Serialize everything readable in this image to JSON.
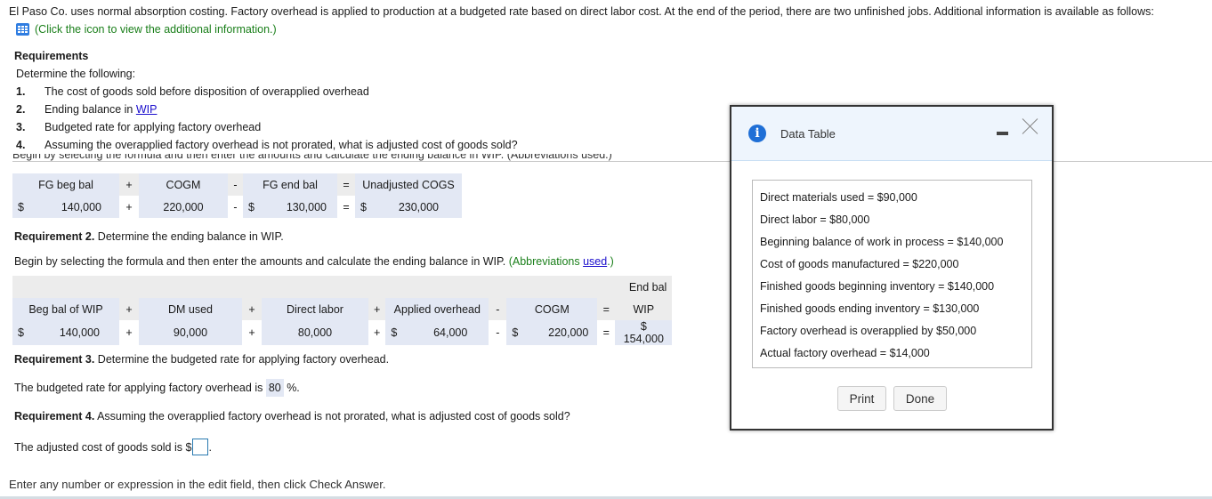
{
  "intro": "El Paso Co. uses normal absorption costing. Factory overhead is applied to production at a budgeted rate based on direct labor cost. At the end of the period, there are two unfinished jobs. Additional information is available as follows:",
  "info_link": "(Click the icon to view the additional information.)",
  "requirements": {
    "title": "Requirements",
    "subtitle": "Determine the following:",
    "items": [
      {
        "num": "1.",
        "text": "The cost of goods sold before disposition of overapplied overhead"
      },
      {
        "num": "2.",
        "text": "Ending balance in ",
        "link": "WIP"
      },
      {
        "num": "3.",
        "text": "Budgeted rate for applying factory overhead"
      },
      {
        "num": "4.",
        "text": "Assuming the overapplied factory overhead is not prorated, what is adjusted cost of goods sold?"
      }
    ]
  },
  "cut_text": "Begin by selecting the formula and then enter the amounts and calculate the ending balance in WIP. (Abbreviations used.)",
  "formula1": {
    "headers": [
      "FG beg bal",
      "+",
      "COGM",
      "-",
      "FG end bal",
      "=",
      "Unadjusted COGS"
    ],
    "values": {
      "fg_beg": "140,000",
      "op1": "+",
      "cogm": "220,000",
      "op2": "-",
      "fg_end": "130,000",
      "op3": "=",
      "unadj": "230,000"
    },
    "currency": "$"
  },
  "req2": {
    "label": "Requirement 2.",
    "text": " Determine the ending balance in WIP.",
    "instruction": "Begin by selecting the formula and then enter the amounts and calculate the ending balance in WIP. ",
    "abbr_pre": "(Abbreviations ",
    "abbr_link": "used",
    "abbr_post": ".)"
  },
  "formula2": {
    "top_header": "End bal",
    "headers": [
      "Beg bal of WIP",
      "+",
      "DM used",
      "+",
      "Direct labor",
      "+",
      "Applied overhead",
      "-",
      "COGM",
      "=",
      "WIP"
    ],
    "values": {
      "beg_wip": "140,000",
      "op1": "+",
      "dm": "90,000",
      "op2": "+",
      "dl": "80,000",
      "op3": "+",
      "applied": "64,000",
      "op4": "-",
      "cogm": "220,000",
      "op5": "=",
      "end_wip": "$ 154,000"
    },
    "currency": "$"
  },
  "req3": {
    "label": "Requirement 3.",
    "text": " Determine the budgeted rate for applying factory overhead.",
    "sentence_pre": "The budgeted rate for applying factory overhead is ",
    "rate": "80",
    "sentence_post": " %."
  },
  "req4": {
    "label": "Requirement 4.",
    "text": " Assuming the overapplied factory overhead is not prorated, what is adjusted cost of goods sold?",
    "sentence_pre": "The adjusted cost of goods sold is $",
    "answer": "",
    "sentence_post": "."
  },
  "footer": "Enter any number or expression in the edit field, then click Check Answer.",
  "dialog": {
    "title": "Data Table",
    "lines": [
      "Direct materials used = $90,000",
      "Direct labor = $80,000",
      "Beginning balance of work in process = $140,000",
      "Cost of goods manufactured = $220,000",
      "Finished goods beginning inventory = $140,000",
      "Finished goods ending inventory = $130,000",
      "Factory overhead is overapplied by $50,000",
      "Actual factory overhead = $14,000"
    ],
    "print_label": "Print",
    "done_label": "Done"
  }
}
